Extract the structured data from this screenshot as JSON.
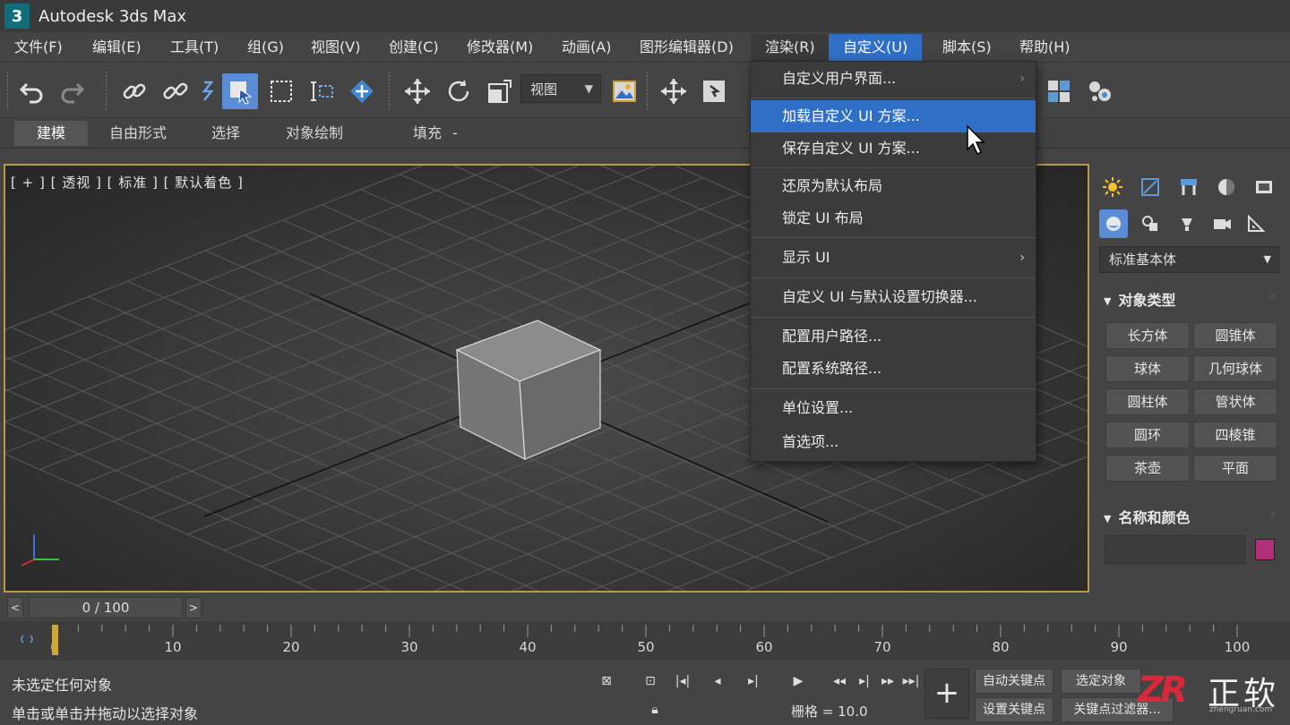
{
  "window": {
    "logo_text": "3",
    "title": "Autodesk 3ds Max"
  },
  "menubar": [
    "文件(F)",
    "编辑(E)",
    "工具(T)",
    "组(G)",
    "视图(V)",
    "创建(C)",
    "修改器(M)",
    "动画(A)",
    "图形编辑器(D)",
    "渲染(R)",
    "自定义(U)",
    "脚本(S)",
    "帮助(H)"
  ],
  "toolbar": {
    "view_select": "视图"
  },
  "ribbon": {
    "tabs": [
      "建模",
      "自由形式",
      "选择",
      "对象绘制",
      "填充"
    ],
    "extra": "-"
  },
  "viewport": {
    "label": "[ + ] [ 透视 ] [ 标准 ] [ 默认着色 ]"
  },
  "dropdown_menu": {
    "items": [
      {
        "label": "自定义用户界面...",
        "submenu": true
      },
      {
        "label": "加载自定义 UI 方案...",
        "highlighted": true
      },
      {
        "label": "保存自定义 UI 方案..."
      },
      {
        "label": "还原为默认布局"
      },
      {
        "label": "锁定 UI 布局"
      },
      {
        "label": "显示 UI",
        "submenu": true
      },
      {
        "label": "自定义 UI 与默认设置切换器..."
      },
      {
        "label": "配置用户路径..."
      },
      {
        "label": "配置系统路径..."
      },
      {
        "label": "单位设置..."
      },
      {
        "label": "首选项..."
      }
    ],
    "arrow_glyph": "›"
  },
  "command_panel": {
    "category": "标准基本体",
    "object_type_title": "对象类型",
    "object_buttons": [
      "长方体",
      "圆锥体",
      "球体",
      "几何球体",
      "圆柱体",
      "管状体",
      "圆环",
      "四棱锥",
      "茶壶",
      "平面"
    ],
    "name_color_title": "名称和颜色",
    "object_color": "#b0307a",
    "collapse_glyph": "▼"
  },
  "timeline": {
    "frame": "0 / 100",
    "prev": "<",
    "next": ">",
    "ticks": [
      "0",
      "10",
      "20",
      "30",
      "40",
      "50",
      "60",
      "70",
      "80",
      "90",
      "100"
    ]
  },
  "status": {
    "line1": "未选定任何对象",
    "line2": "单击或单击并拖动以选择对象",
    "grid": "栅格 = 10.0",
    "auto_key": "自动关键点",
    "selected": "选定对象",
    "set_key": "设置关键点",
    "key_filters": "关键点过滤器...",
    "add_glyph": "+"
  },
  "watermark": {
    "logo": "ZR",
    "text": "正软",
    "url": "zhengruan.com"
  },
  "colors": {
    "accent": "#2f6fc6",
    "viewport_border": "#b99a43",
    "watermark_red": "#d8283a"
  }
}
